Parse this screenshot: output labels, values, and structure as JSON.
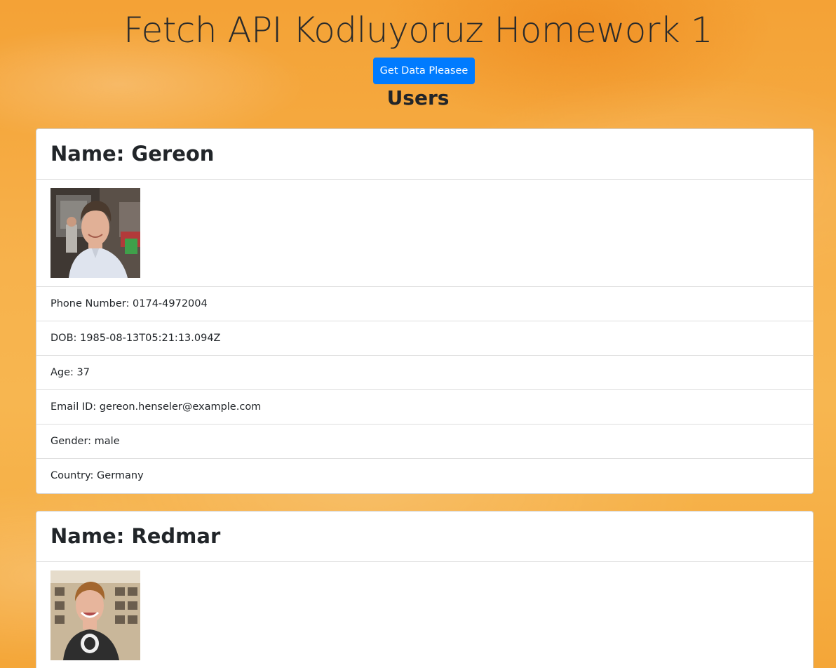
{
  "page": {
    "title": "Fetch API Kodluyoruz Homework 1",
    "button_label": "Get Data Pleasee",
    "users_heading": "Users"
  },
  "colors": {
    "background": "#f5a83e",
    "button": "#007bff",
    "card": "#ffffff"
  },
  "users": [
    {
      "name_line": "Name: Gereon",
      "phone_line": "Phone Number: 0174-4972004",
      "dob_line": "DOB: 1985-08-13T05:21:13.094Z",
      "age_line": "Age: 37",
      "email_line": "Email ID: gereon.henseler@example.com",
      "gender_line": "Gender: male",
      "country_line": "Country: Germany"
    },
    {
      "name_line": "Name: Redmar"
    }
  ]
}
